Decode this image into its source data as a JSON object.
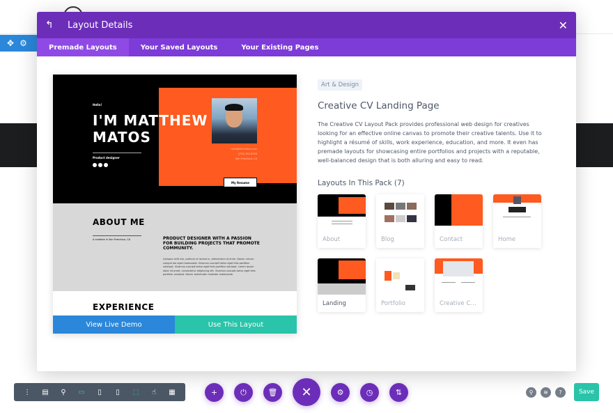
{
  "modal": {
    "title": "Layout Details",
    "back_icon": "back-arrow-icon",
    "close_icon": "close-icon",
    "tabs": [
      {
        "label": "Premade Layouts",
        "active": true
      },
      {
        "label": "Your Saved Layouts",
        "active": false
      },
      {
        "label": "Your Existing Pages",
        "active": false
      }
    ]
  },
  "preview": {
    "hello": "Hello!",
    "name": "I'M MATTHEW MATOS",
    "role": "Product designer",
    "contact": [
      "hello@divimatos.com",
      "(255) 352-6258",
      "San Francisco, CA"
    ],
    "resume_button": "My Resume",
    "about_title": "ABOUT ME",
    "about_sub": "A creative in San Francisco, CA",
    "about_heading": "PRODUCT DESIGNER WITH A PASSION FOR BUILDING PROJECTS THAT PROMOTE COMMUNITY.",
    "about_body": "Quisque velit nisi, pretium ut lacinia in, elementum id enim. Donec rutrum congue leo eget malesuada. Vivamus suscipit tortor eget felis porttitor volutpat. Vivamus suscipit tortor eget felis porttitor volutpat. Lorem ipsum dolor sit amet, consectetur adipiscing elit. Vivamus suscipit tortor eget felis porttitor volutpat. Donec sollicitudin molestie malesuada.",
    "experience_title": "EXPERIENCE",
    "view_demo": "View Live Demo",
    "use_layout": "Use This Layout"
  },
  "info": {
    "category": "Art & Design",
    "title": "Creative CV Landing Page",
    "description": "The Creative CV Layout Pack provides professional web design for creatives looking for an effective online canvas to promote their creative talents. Use it to highlight a résumé of skills, work experience, education, and more. It even has premade layouts for showcasing entire portfolios and projects with a reputable, well-balanced design that is both alluring and easy to read.",
    "pack_title": "Layouts In This Pack (7)",
    "layouts": [
      {
        "label": "About",
        "selected": false
      },
      {
        "label": "Blog",
        "selected": false
      },
      {
        "label": "Contact",
        "selected": false
      },
      {
        "label": "Home",
        "selected": false
      },
      {
        "label": "Landing",
        "selected": true
      },
      {
        "label": "Portfolio",
        "selected": false
      },
      {
        "label": "Creative CV...",
        "selected": false
      }
    ]
  },
  "bottom": {
    "left_tools": [
      "more-icon",
      "wireframe-icon",
      "zoom-icon",
      "desktop-icon",
      "tablet-icon",
      "phone-icon"
    ],
    "left_tools2": [
      "select-icon",
      "click-mode-icon",
      "grid-icon"
    ],
    "center_buttons": [
      "add-icon",
      "power-icon",
      "trash-icon",
      "close-icon",
      "gear-icon",
      "history-icon",
      "sort-icon"
    ],
    "right_buttons": [
      "search-icon",
      "layers-icon",
      "help-icon"
    ],
    "save_label": "Save"
  },
  "colors": {
    "purple": "#6c2eb9",
    "tab_purple": "#7d3bd8",
    "blue": "#2b87da",
    "teal": "#29c4a9",
    "orange": "#ff5a1f"
  }
}
